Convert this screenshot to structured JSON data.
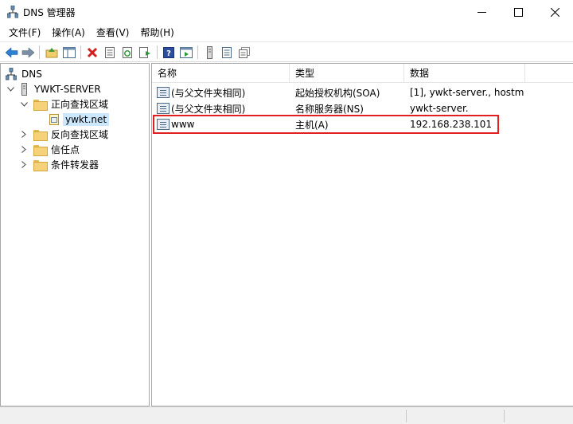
{
  "window": {
    "title": "DNS 管理器"
  },
  "menu": [
    "文件(F)",
    "操作(A)",
    "查看(V)",
    "帮助(H)"
  ],
  "toolbar": {
    "buttons": [
      "back-icon",
      "forward-icon",
      "up-folder-icon",
      "show-hide-tree-icon",
      "delete-icon",
      "properties-icon",
      "refresh-icon",
      "export-list-icon",
      "help-icon",
      "action-pane-icon",
      "server-icon",
      "list-icon",
      "records-icon"
    ]
  },
  "tree": {
    "root": "DNS",
    "server": "YWKT-SERVER",
    "forward_zones": "正向查找区域",
    "zone": "ywkt.net",
    "reverse_zones": "反向查找区域",
    "trust_points": "信任点",
    "conditional_forwarders": "条件转发器"
  },
  "list": {
    "columns": [
      "名称",
      "类型",
      "数据"
    ],
    "rows": [
      {
        "name": "(与父文件夹相同)",
        "type": "起始授权机构(SOA)",
        "data": "[1], ywkt-server., hostm..."
      },
      {
        "name": "(与父文件夹相同)",
        "type": "名称服务器(NS)",
        "data": "ywkt-server."
      },
      {
        "name": "www",
        "type": "主机(A)",
        "data": "192.168.238.101"
      }
    ]
  }
}
